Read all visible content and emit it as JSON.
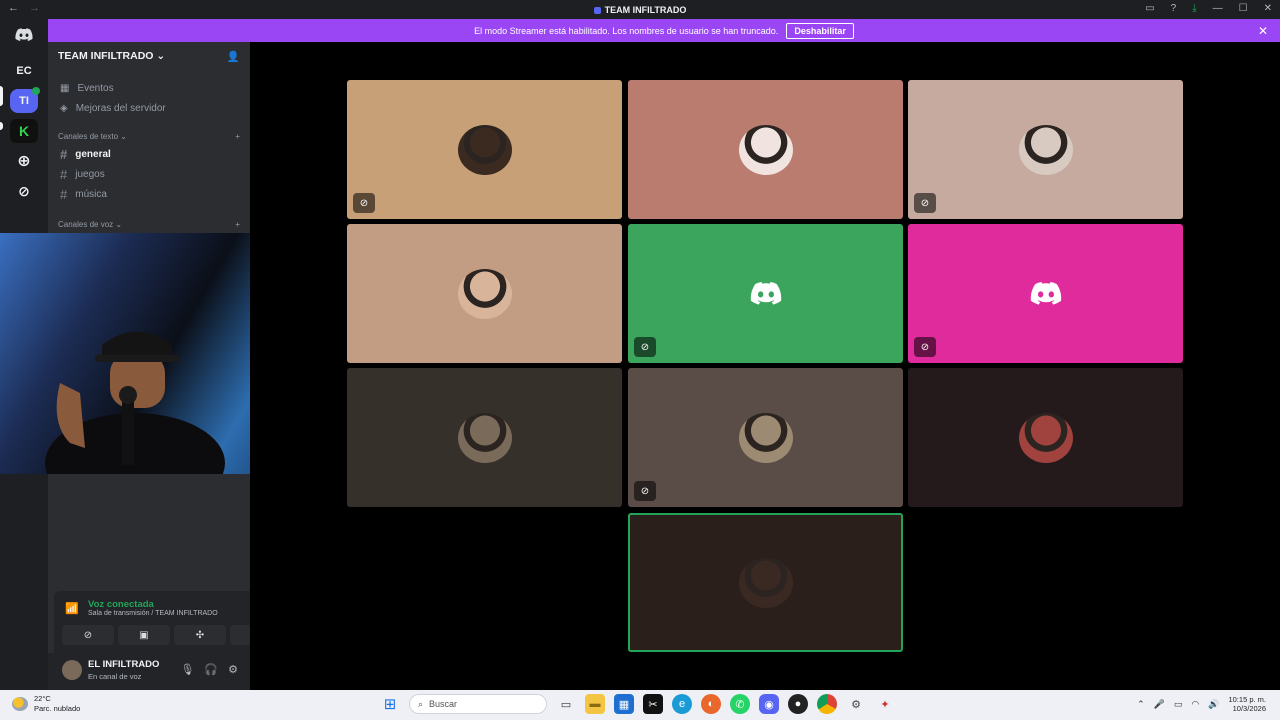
{
  "window": {
    "title": "TEAM INFILTRADO",
    "back": "←",
    "forward": "→"
  },
  "banner": {
    "message": "El modo Streamer está habilitado. Los nombres de usuario se han truncado.",
    "button": "Deshabilitar"
  },
  "guilds": [
    {
      "label": "EC"
    },
    {
      "label": "TI"
    }
  ],
  "server": {
    "name": "TEAM INFILTRADO",
    "items": [
      {
        "label": "Eventos"
      },
      {
        "label": "Mejoras del servidor"
      }
    ],
    "text_category": "Canales de texto",
    "text_channels": [
      {
        "name": "general"
      },
      {
        "name": "juegos"
      },
      {
        "name": "música"
      }
    ],
    "voice_category": "Canales de voz"
  },
  "voice": {
    "status": "Voz conectada",
    "location": "Sala de transmisión / TEAM INFILTRADO"
  },
  "user": {
    "name": "EL INFILTRADO",
    "status": "En canal de voz"
  },
  "tiles": [
    {
      "bg": "#c8a078",
      "kind": "avatar",
      "muted": true,
      "avatar": "#3b2a20"
    },
    {
      "bg": "#b97c6f",
      "kind": "avatar",
      "muted": false,
      "avatar": "#f1e3e0"
    },
    {
      "bg": "#c6aaa0",
      "kind": "avatar",
      "muted": true,
      "avatar": "#d8c9c1"
    },
    {
      "bg": "#c29d84",
      "kind": "avatar",
      "muted": false,
      "avatar": "#d8b59a"
    },
    {
      "bg": "#3ba55d",
      "kind": "logo",
      "muted": true
    },
    {
      "bg": "#e02b9d",
      "kind": "logo",
      "muted": true
    },
    {
      "bg": "#35302a",
      "kind": "avatar",
      "muted": false,
      "avatar": "#7a6a5a"
    },
    {
      "bg": "#5a4c47",
      "kind": "avatar",
      "muted": true,
      "avatar": "#9c8a72"
    },
    {
      "bg": "#241a1c",
      "kind": "avatar",
      "muted": false,
      "avatar": "#a0423d"
    },
    {
      "bg": "#2a1f1b",
      "kind": "avatar",
      "muted": false,
      "avatar": "#3a2822",
      "speaking": true
    }
  ],
  "taskbar": {
    "temperature": "22°C",
    "condition": "Parc. nublado",
    "search_placeholder": "Buscar",
    "time": "10:15 p. m.",
    "date": "10/3/2026"
  },
  "colors": {
    "accent": "#5865f2",
    "streamer_banner": "#9b46f5",
    "voice_green": "#23a559"
  }
}
